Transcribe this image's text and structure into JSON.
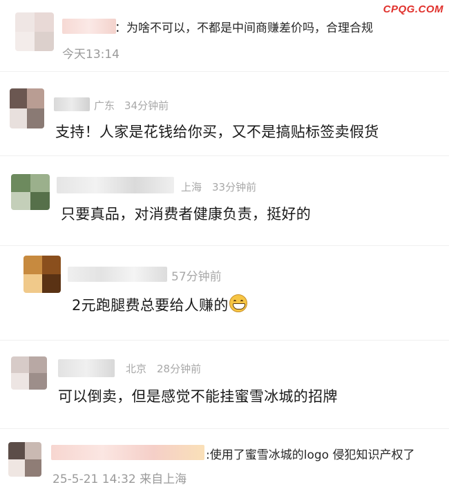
{
  "watermark": "CPQG.COM",
  "comments": [
    {
      "inline_text": "：为啥不可以，不都是中间商赚差价吗，合理合规",
      "time": "今天13:14",
      "avatar_colors": [
        "#efe6e4",
        "#e8d9d6",
        "#f3ecea",
        "#dcd0cc"
      ]
    },
    {
      "location": "广东",
      "ago": "34分钟前",
      "text": "支持！人家是花钱给你买，又不是搞贴标签卖假货",
      "avatar_colors": [
        "#6b5751",
        "#b99d93",
        "#e8e0dd",
        "#8a7a74"
      ]
    },
    {
      "location": "上海",
      "ago": "33分钟前",
      "text": "只要真品，对消费者健康负责，挺好的",
      "avatar_colors": [
        "#6d8a5e",
        "#9bb08c",
        "#c4cfb9",
        "#56704a"
      ]
    },
    {
      "ago": "57分钟前",
      "text": "2元跑腿费总要给人赚的",
      "emoji": "grinning-face",
      "avatar_colors": [
        "#c78a3f",
        "#8a4f1d",
        "#f0c98a",
        "#5a3214"
      ]
    },
    {
      "location": "北京",
      "ago": "28分钟前",
      "text": "可以倒卖，但是感觉不能挂蜜雪冰城的招牌",
      "avatar_colors": [
        "#d7cbc8",
        "#b8a8a4",
        "#ede5e3",
        "#9d8e8a"
      ]
    },
    {
      "inline_text": ":使用了蜜雪冰城的logo 侵犯知识产权了",
      "time": "25-5-21 14:32 来自上海",
      "avatar_colors": [
        "#5c4d48",
        "#c9b9b2",
        "#efe6e2",
        "#8f7d76"
      ]
    }
  ]
}
